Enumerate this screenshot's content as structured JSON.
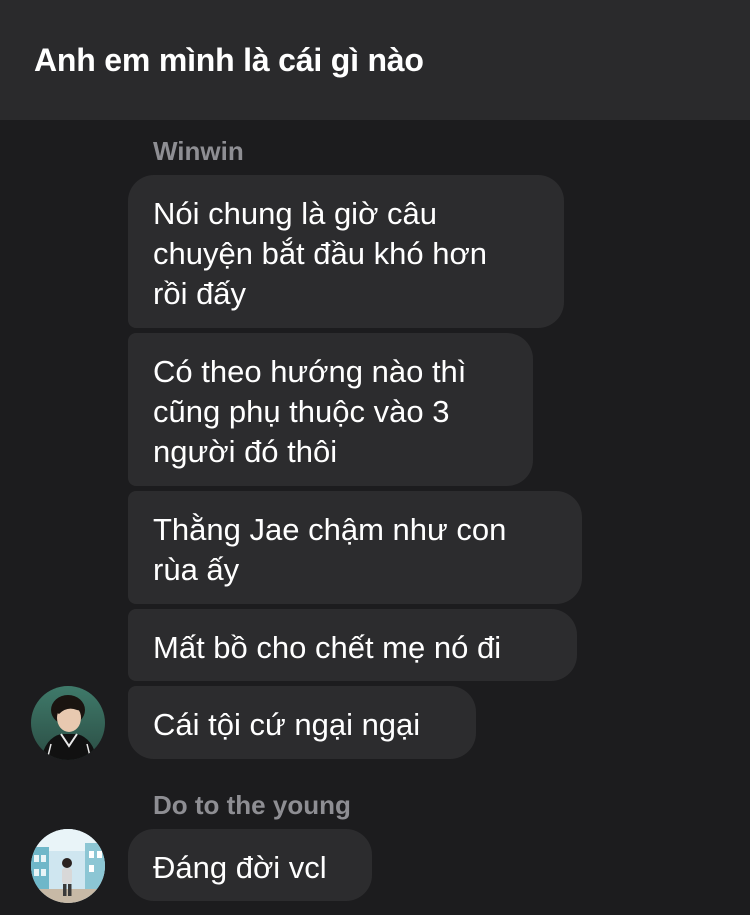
{
  "header": {
    "title": "Anh em mình là cái gì nào"
  },
  "groups": [
    {
      "sender": "Winwin",
      "avatar": "person-avatar-dark-jacket",
      "messages": [
        "Nói chung là giờ câu\nchuyện bắt đầu khó hơn\nrồi đấy",
        "Có theo hướng nào thì\ncũng phụ thuộc vào 3\nngười đó thôi",
        "Thằng Jae chậm như con\nrùa ấy",
        "Mất bồ cho chết mẹ nó đi",
        "Cái tội cứ ngại ngại"
      ]
    },
    {
      "sender": "Do to the young",
      "avatar": "person-avatar-outdoor",
      "messages": [
        "Đáng đời vcl"
      ]
    }
  ],
  "colors": {
    "background": "#1c1c1e",
    "header": "#2a2a2c",
    "bubble": "#2c2c2e",
    "sender_name": "#8e8e93",
    "text": "#ffffff"
  }
}
